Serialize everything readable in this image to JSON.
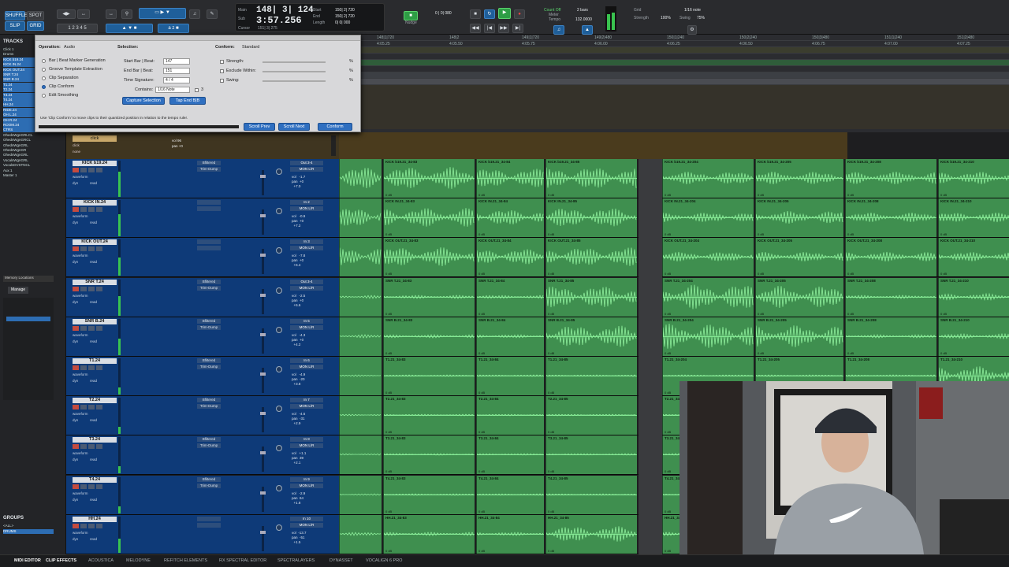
{
  "transport": {
    "counter_main": "148| 3| 124",
    "counter_sub": "3:57.256",
    "main_label": "Main",
    "sub_label": "Sub",
    "start_label": "Start",
    "end_label": "End",
    "length_label": "Length",
    "start_val": "150| 2| 720",
    "end_val": "150| 2| 720",
    "length_val": "0| 0| 000",
    "cursor_label": "Cursor",
    "cursor_val": "151| 3| 275",
    "nudge_label": "Nudge",
    "nudge_val": "0 | 0| 080",
    "grid_label": "Grid",
    "grid_val": "1/16 note",
    "count_off": "Count Off",
    "meter_label": "Meter",
    "tempo_label": "Tempo",
    "meter_val": "2 bars",
    "tempo_val": "132.0000",
    "strength_label": "Strength",
    "strength_val": "100%",
    "swing_label": "Swing",
    "swing_val": "75%",
    "edit_mode": "SHUFFLE",
    "edit_mode2": "SPOT",
    "slip": "SLIP",
    "grid_mode": "GRID"
  },
  "sidebar": {
    "tracks_header": "TRACKS",
    "memory_header": "Memory Locations",
    "groups_header": "GROUPS",
    "manage_label": "Manage",
    "track_items": [
      "Click 1",
      "Drums",
      "KICK b19.24",
      "KICK IN.24",
      "KICK OUT.24",
      "SNR T.24",
      "SNR B.24",
      "T1.24",
      "T2.24",
      "T3.24",
      "T4.24",
      "HH.24",
      "RIDE.24",
      "OH L.24",
      "OH R.24",
      "ROOM.24",
      "CTRS",
      "OhedsWgnGRLCL",
      "OhedsWgnGRCL",
      "OhedsWgnGRL",
      "OhedsWgnGR",
      "OhedsWgnGRL",
      "VocalsWgnGRL",
      "VocalsDVSTNCL",
      "Aux 1",
      "Master 1"
    ],
    "groups_items": [
      "<ALL>",
      "DRUMS"
    ]
  },
  "panel": {
    "operation_label": "Operation:",
    "operation_val": "Audio",
    "selection_label": "Selection:",
    "conform_label": "Conform:",
    "conform_val": "Standard",
    "ops": [
      "Bar | Beat Marker Generation",
      "Groove Template Extraction",
      "Clip Separation",
      "Clip Conform",
      "Edit Smoothing"
    ],
    "start_bar_label": "Start Bar | Beat:",
    "start_bar_val": "147",
    "end_bar_label": "End Bar | Beat:",
    "end_bar_val": "151",
    "time_sig_label": "Time Signature:",
    "time_sig_val": "4 / 4",
    "contains_label": "Contains:",
    "contains_val": "1/16 Note",
    "contains_num": "3",
    "capture_btn": "Capture Selection",
    "tap_btn": "Tap End B|B",
    "strength_label": "Strength:",
    "exclude_label": "Exclude Within:",
    "swing_label": "Swing:",
    "pct": "%",
    "hint": "Use 'Clip Conform' to move clips to their quantized position in relation to the tempo ruler.",
    "scroll_prev": "Scroll Prev",
    "scroll_next": "Scroll Next",
    "conform_btn": "Conform"
  },
  "click_track": {
    "name": "click",
    "sub1": "click",
    "sub2": "none",
    "vol": "vol  96",
    "pan": "pan  +0"
  },
  "tracks": [
    {
      "name": "KICK b19.24",
      "clip_prefix": "KICK b19.21_34-",
      "insert": "Bfiltered",
      "insert2": "Trim-Dump",
      "io": "Out 3-4",
      "io2": "MON L/R",
      "vol": "vol   -1.7\npan  +0\n  +7.0",
      "meter": 0.7
    },
    {
      "name": "KICK IN.24",
      "clip_prefix": "KICK IN.21_34-",
      "insert": "",
      "insert2": "",
      "io": "In 2",
      "io2": "MON L/R",
      "vol": "vol   -0.9\npan  +0\n  +7.2",
      "meter": 0.6
    },
    {
      "name": "KICK OUT.24",
      "clip_prefix": "KICK OUT.21_34-",
      "insert": "",
      "insert2": "",
      "io": "In 3",
      "io2": "MON L/R",
      "vol": "vol   -7.8\npan  +0\n  +6.4",
      "meter": 0.5
    },
    {
      "name": "SNR T.24",
      "clip_prefix": "SNR T.21_34-",
      "insert": "Bfiltered",
      "insert2": "Trim-Dump",
      "io": "Out 3-4",
      "io2": "MON L/R",
      "vol": "vol   -2.5\npan  +0\n  +5.6",
      "meter": 0.55
    },
    {
      "name": "SNR B.24",
      "clip_prefix": "SNR B.21_34-",
      "insert": "Bfiltered",
      "insert2": "Trim-Dump",
      "io": "In 5",
      "io2": "MON L/R",
      "vol": "vol   -4.3\npan  +0\n  +4.2",
      "meter": 0.45
    },
    {
      "name": "T1.24",
      "clip_prefix": "T1.21_34-",
      "insert": "Bfiltered",
      "insert2": "Trim-Dump",
      "io": "In 6",
      "io2": "MON L/R",
      "vol": "vol   -4.9\npan  -20\n  +3.8",
      "meter": 0.2
    },
    {
      "name": "T2.24",
      "clip_prefix": "T2.21_34-",
      "insert": "Bfiltered",
      "insert2": "Trim-Dump",
      "io": "In 7",
      "io2": "MON L/R",
      "vol": "vol   -4.6\npan  -31\n  +2.9",
      "meter": 0.2
    },
    {
      "name": "T3.24",
      "clip_prefix": "T3.21_34-",
      "insert": "Bfiltered",
      "insert2": "Trim-Dump",
      "io": "In 8",
      "io2": "MON L/R",
      "vol": "vol   +1.1\npan  39\n  +2.1",
      "meter": 0.2
    },
    {
      "name": "T4.24",
      "clip_prefix": "T4.21_34-",
      "insert": "Bfiltered",
      "insert2": "Trim-Dump",
      "io": "In 9",
      "io2": "MON L/R",
      "vol": "vol   -2.9\npan  64\n  +1.8",
      "meter": 0.2
    },
    {
      "name": "HH.24",
      "clip_prefix": "HH.21_34-",
      "insert": "",
      "insert2": "",
      "io": "In 10",
      "io2": "MON L/R",
      "vol": "vol  -13.7\npan  -51\n  +1.5",
      "meter": 0.4
    }
  ],
  "clip_suffixes": [
    "83",
    "84",
    "85",
    "86",
    "204",
    "205",
    "208",
    "210"
  ],
  "clip_db": "0 dB",
  "lane_labels": {
    "waveform": "waveform",
    "dyn": "dyn",
    "read": "read"
  },
  "bottom_tabs": [
    "MIDI EDITOR",
    "CLIP EFFECTS",
    "ACOUSTICA",
    "MELODYNE",
    "REFITCH ELEMENTS",
    "RX SPECTRAL EDITOR",
    "SPECTRALAYERS",
    "DYNASSET",
    "VOCALIGN 6 PRO"
  ],
  "ruler_marks": [
    "148|1|720",
    "148|2",
    "149|1|720",
    "149|2|480",
    "150|1|240",
    "150|2|240",
    "150|3|480",
    "151|1|240",
    "151|2|480"
  ],
  "ruler_times": [
    "4:05.25",
    "4:05.50",
    "4:05.75",
    "4:06.00",
    "4:06.25",
    "4:06.50",
    "4:06.75",
    "4:07.00",
    "4:07.25"
  ],
  "colors": {
    "clip": "#3f8f4f",
    "wave": "#8ff09d",
    "track": "#0e3a78",
    "accent": "#2f6fc0"
  }
}
